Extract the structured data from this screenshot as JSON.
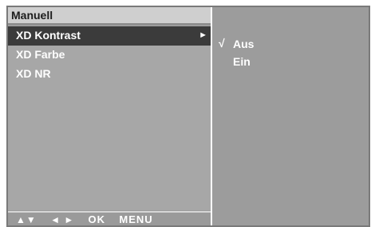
{
  "menu": {
    "title": "Manuell",
    "items": [
      {
        "label": "XD Kontrast",
        "selected": true,
        "arrow": "►"
      },
      {
        "label": "XD Farbe"
      },
      {
        "label": "XD NR"
      }
    ]
  },
  "nav": {
    "updown": "▲▼",
    "leftright": "◄ ►",
    "ok": "OK",
    "menu": "MENU"
  },
  "submenu": {
    "options": [
      {
        "label": "Aus",
        "check": "√",
        "checked": true
      },
      {
        "label": "Ein"
      }
    ]
  },
  "colors": {
    "selected_bg": "#3b3b3b",
    "panel_bg": "#9c9c9c",
    "title_bg": "#cfcfcf"
  }
}
